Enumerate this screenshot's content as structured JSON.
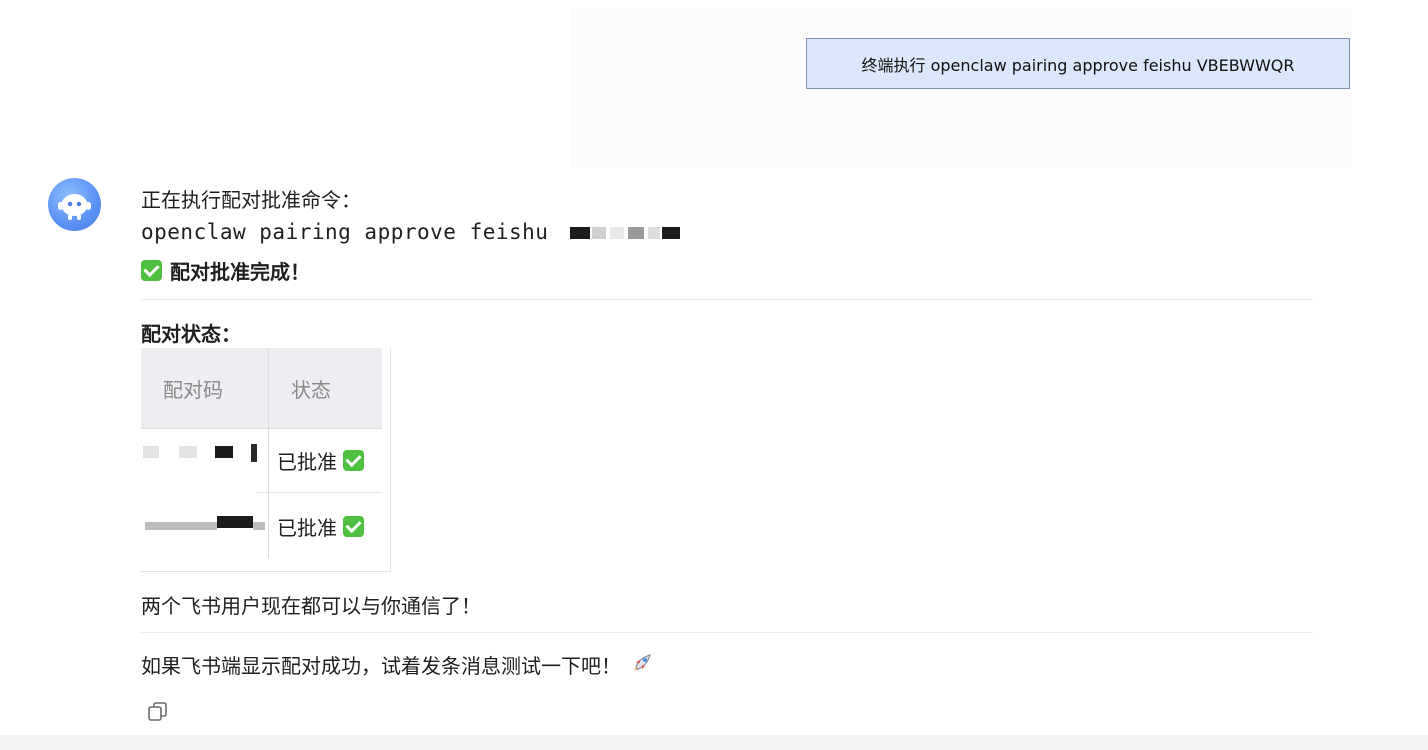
{
  "user_message": "终端执行 openclaw pairing approve feishu VBEBWWQR",
  "assistant": {
    "line1": "正在执行配对批准命令：",
    "command_prefix": "openclaw pairing approve feishu",
    "done": "配对批准完成！",
    "status_title": "配对状态：",
    "table": {
      "headers": [
        "配对码",
        "状态"
      ],
      "rows": [
        {
          "status": "已批准"
        },
        {
          "status": "已批准"
        }
      ]
    },
    "summary": "两个飞书用户现在都可以与你通信了！",
    "final": "如果飞书端显示配对成功，试着发条消息测试一下吧！"
  },
  "icons": {
    "avatar": "robot-avatar-icon",
    "check": "check-mark-icon",
    "rocket": "rocket-icon",
    "copy": "copy-icon"
  },
  "colors": {
    "user_bubble_bg": "#dbe7fb",
    "user_bubble_border": "#7c8fb2",
    "avatar": "#5a90f4",
    "check": "#4fbf3f"
  }
}
